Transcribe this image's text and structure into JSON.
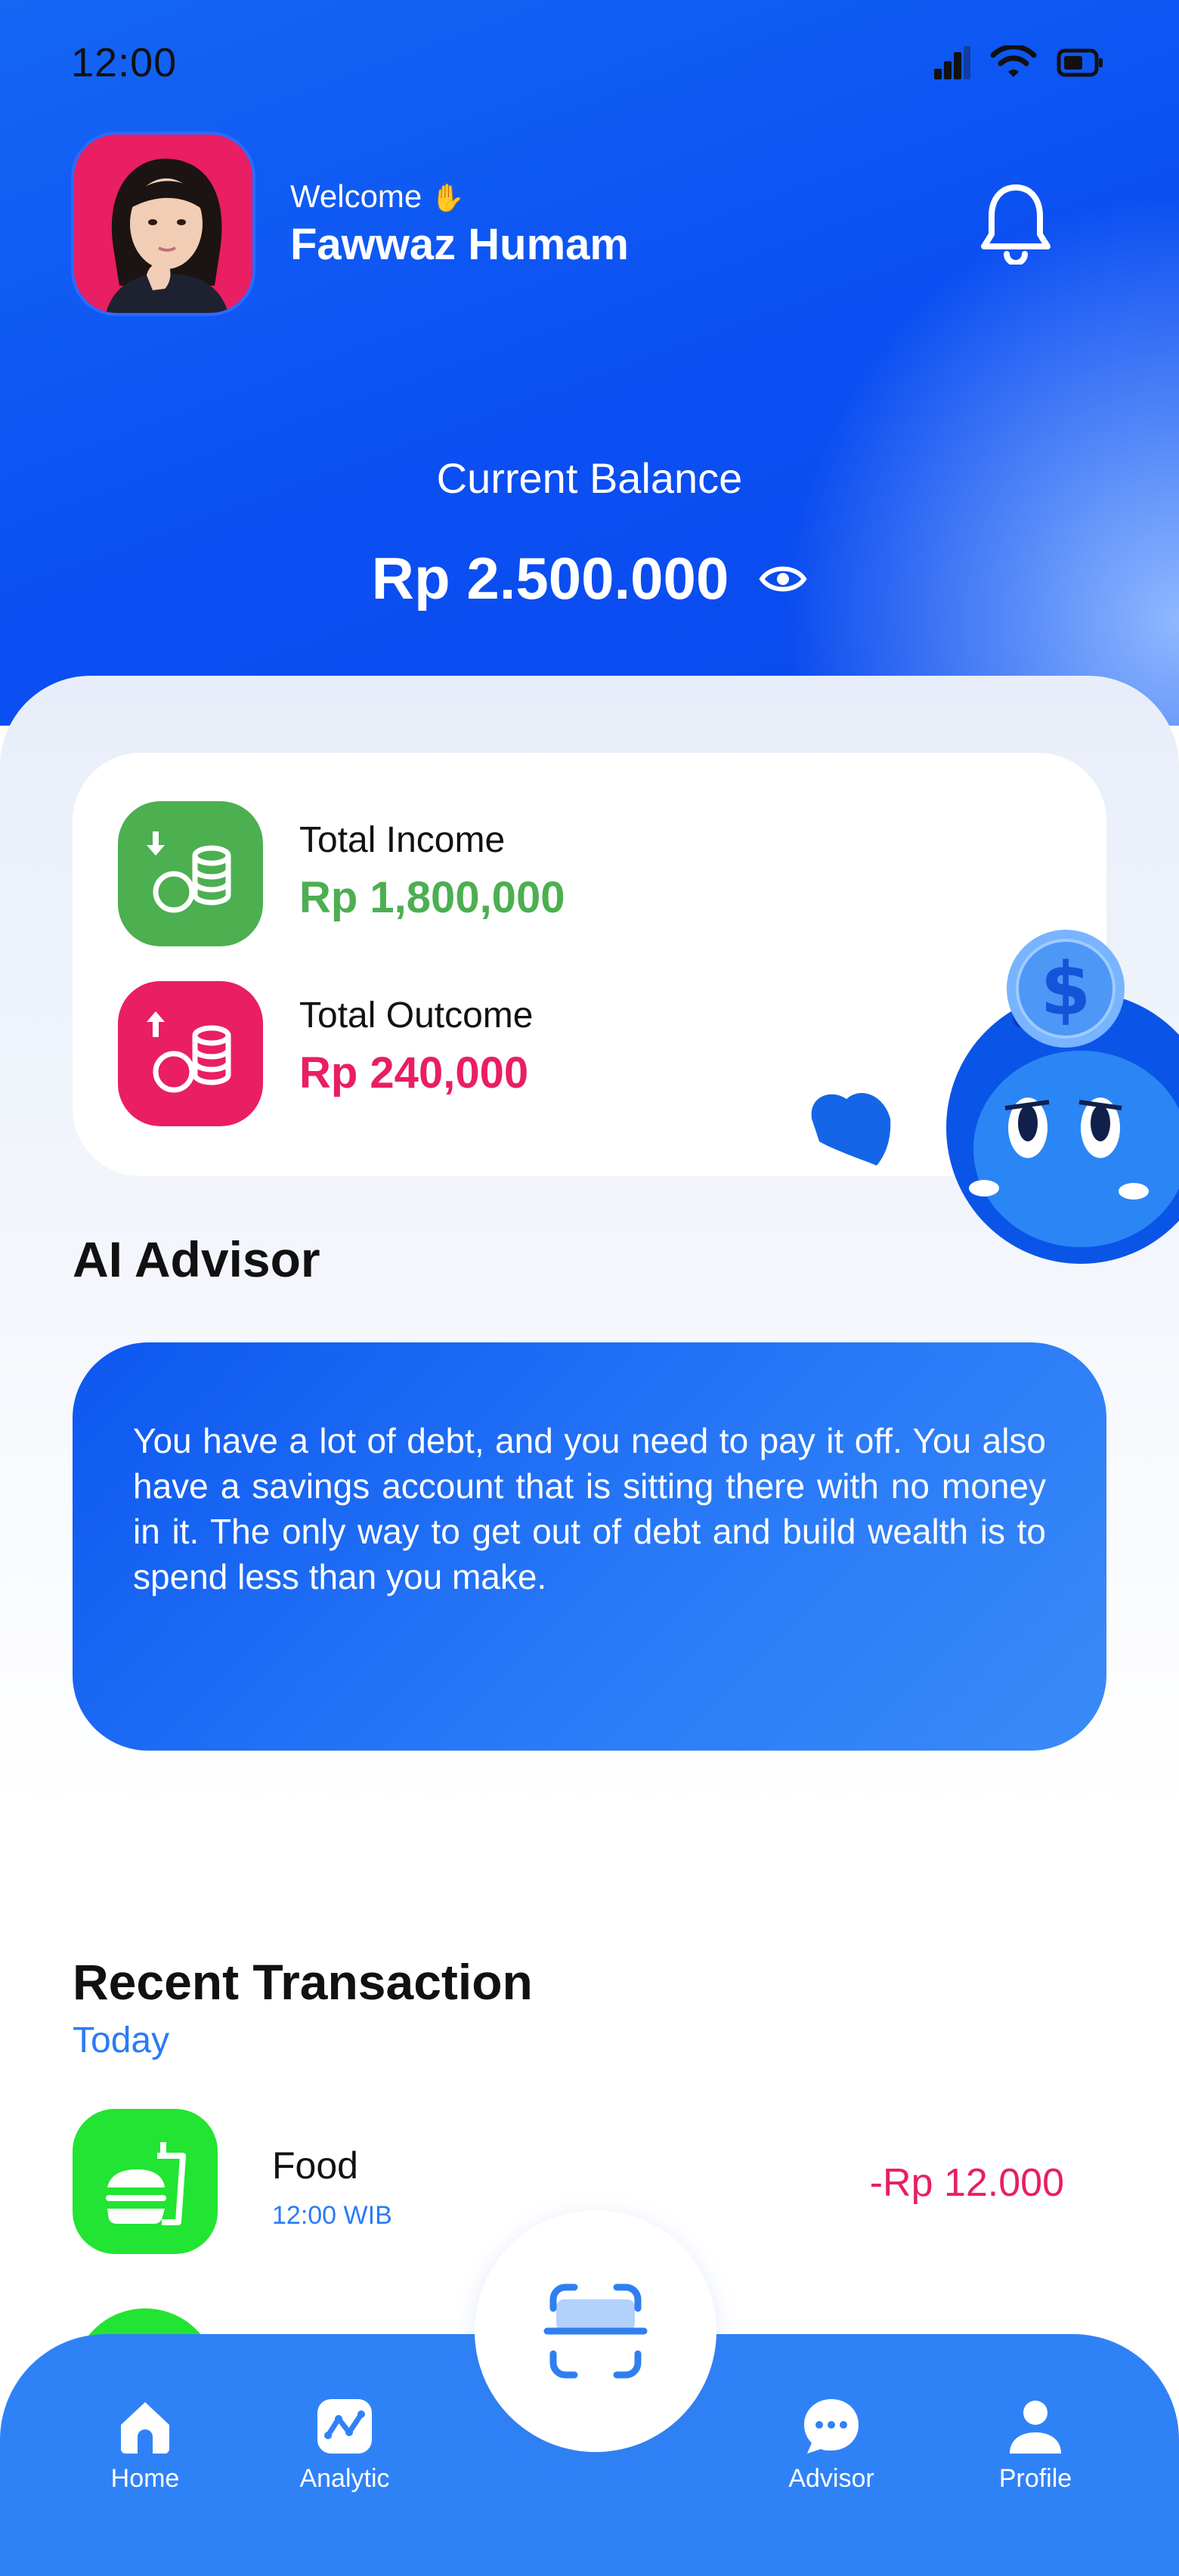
{
  "status_bar": {
    "time": "12:00"
  },
  "header": {
    "welcome": "Welcome",
    "welcome_emoji": "✋",
    "name": "Fawwaz Humam"
  },
  "balance": {
    "label": "Current Balance",
    "value": "Rp 2.500.000"
  },
  "summary": {
    "income_label": "Total Income",
    "income_value": "Rp 1,800,000",
    "outcome_label": "Total Outcome",
    "outcome_value": "Rp 240,000"
  },
  "advisor": {
    "title": "AI Advisor",
    "message": "You have a lot of debt, and you need to pay it off. You also have a savings account that is sitting there with no money in it.  The only way to get out of debt and build wealth is to spend less than you make."
  },
  "transactions": {
    "title": "Recent Transaction",
    "group_label": "Today",
    "items": [
      {
        "name": "Food",
        "time": "12:00 WIB",
        "amount": "-Rp 12.000"
      }
    ]
  },
  "nav": {
    "home": "Home",
    "analytic": "Analytic",
    "advisor": "Advisor",
    "profile": "Profile"
  },
  "colors": {
    "primary": "#0b4ff2",
    "income": "#4caf50",
    "outcome": "#e91e63",
    "nav": "#2f82f6"
  }
}
